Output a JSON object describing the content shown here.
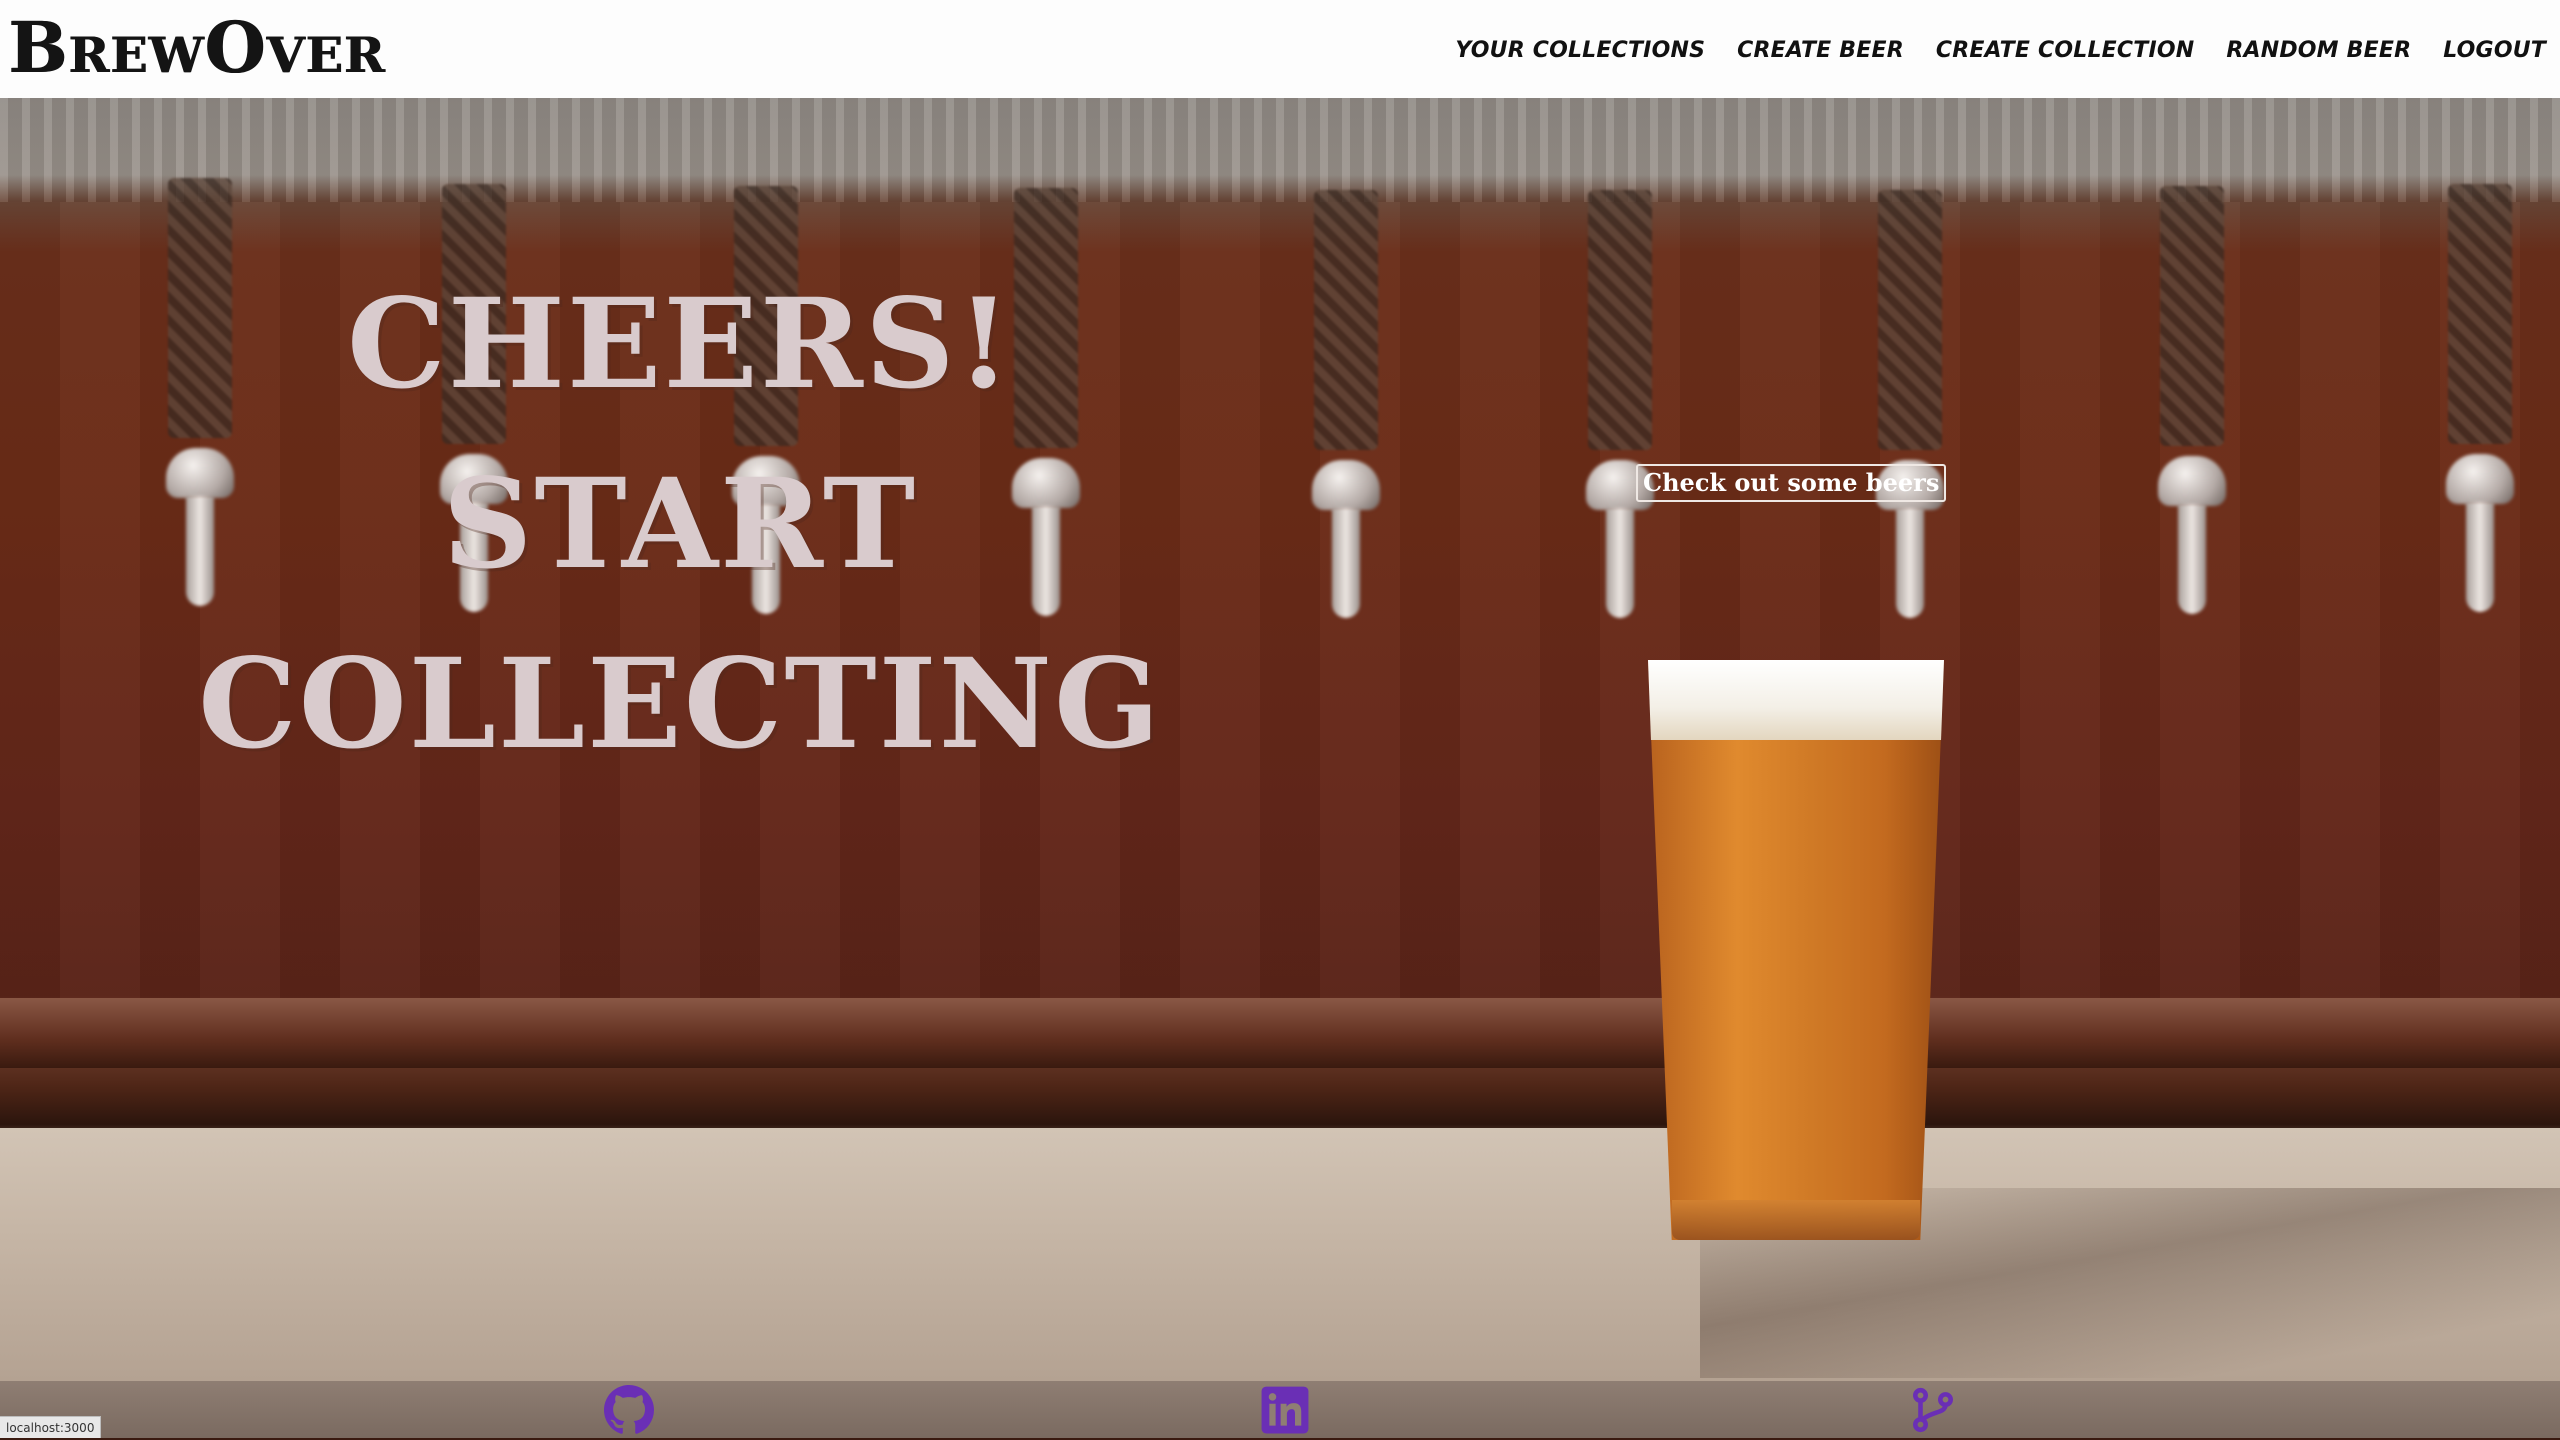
{
  "navbar": {
    "brand": "BrewOver",
    "links": [
      {
        "label": "Your Collections"
      },
      {
        "label": "Create Beer"
      },
      {
        "label": "Create Collection"
      },
      {
        "label": "Random Beer"
      },
      {
        "label": "Logout"
      }
    ]
  },
  "hero": {
    "heading_lines": [
      "CHEERS!",
      "START",
      "COLLECTING"
    ],
    "cta_label": "Check out some beers"
  },
  "footer": {
    "icons": [
      "github-icon",
      "linkedin-icon",
      "git-branch-icon"
    ],
    "icon_color": "#6a2fb5"
  },
  "status_bar": {
    "url": "localhost:3000"
  }
}
